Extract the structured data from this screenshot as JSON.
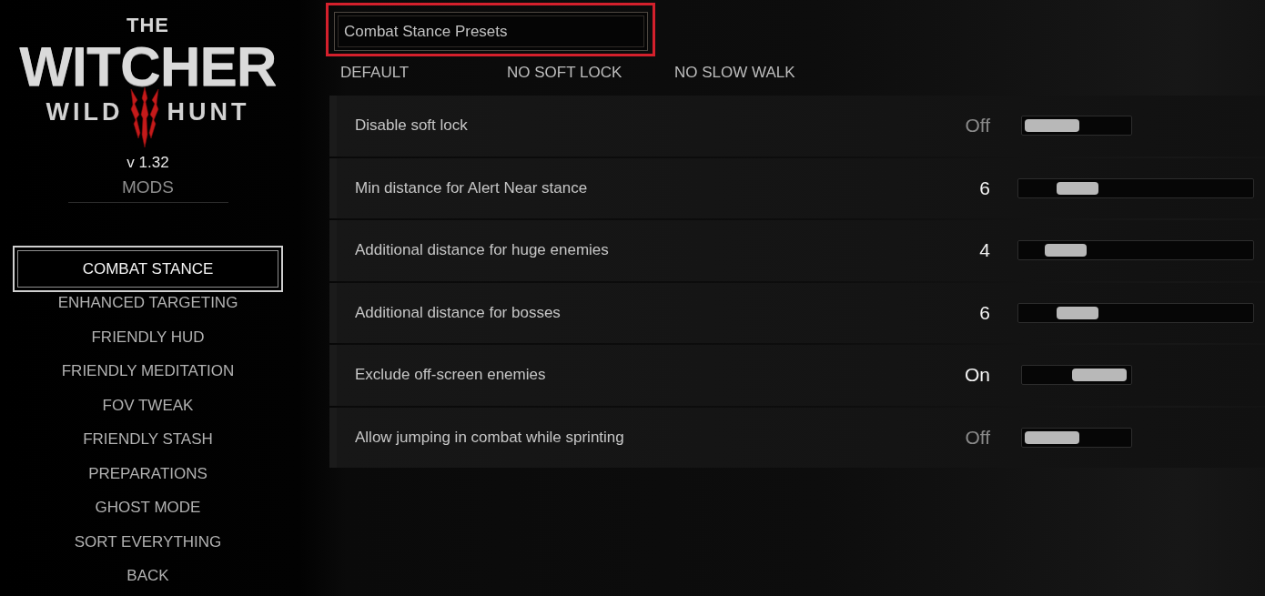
{
  "logo": {
    "top": "THE",
    "title": "WITCHER",
    "left": "WILD",
    "right": "HUNT"
  },
  "version": "v 1.32",
  "section": "MODS",
  "menu": [
    {
      "label": "COMBAT STANCE",
      "selected": true
    },
    {
      "label": "ENHANCED TARGETING",
      "selected": false
    },
    {
      "label": "FRIENDLY HUD",
      "selected": false
    },
    {
      "label": "FRIENDLY MEDITATION",
      "selected": false
    },
    {
      "label": "FOV TWEAK",
      "selected": false
    },
    {
      "label": "FRIENDLY STASH",
      "selected": false
    },
    {
      "label": "PREPARATIONS",
      "selected": false
    },
    {
      "label": "GHOST MODE",
      "selected": false
    },
    {
      "label": "SORT EVERYTHING",
      "selected": false
    },
    {
      "label": "BACK",
      "selected": false
    }
  ],
  "presets_header": {
    "label": "Combat Stance Presets",
    "highlighted": true
  },
  "presets": [
    "DEFAULT",
    "NO SOFT LOCK",
    "NO SLOW WALK"
  ],
  "settings": [
    {
      "kind": "toggle",
      "label": "Disable soft lock",
      "value": "Off",
      "on": false
    },
    {
      "kind": "slider",
      "label": "Min distance for Alert Near stance",
      "value": "6",
      "level": 0.1875
    },
    {
      "kind": "slider",
      "label": "Additional distance for huge enemies",
      "value": "4",
      "level": 0.125
    },
    {
      "kind": "slider",
      "label": "Additional distance for bosses",
      "value": "6",
      "level": 0.1875
    },
    {
      "kind": "toggle",
      "label": "Exclude off-screen enemies",
      "value": "On",
      "on": true
    },
    {
      "kind": "toggle",
      "label": "Allow jumping in combat while sprinting",
      "value": "Off",
      "on": false
    }
  ]
}
